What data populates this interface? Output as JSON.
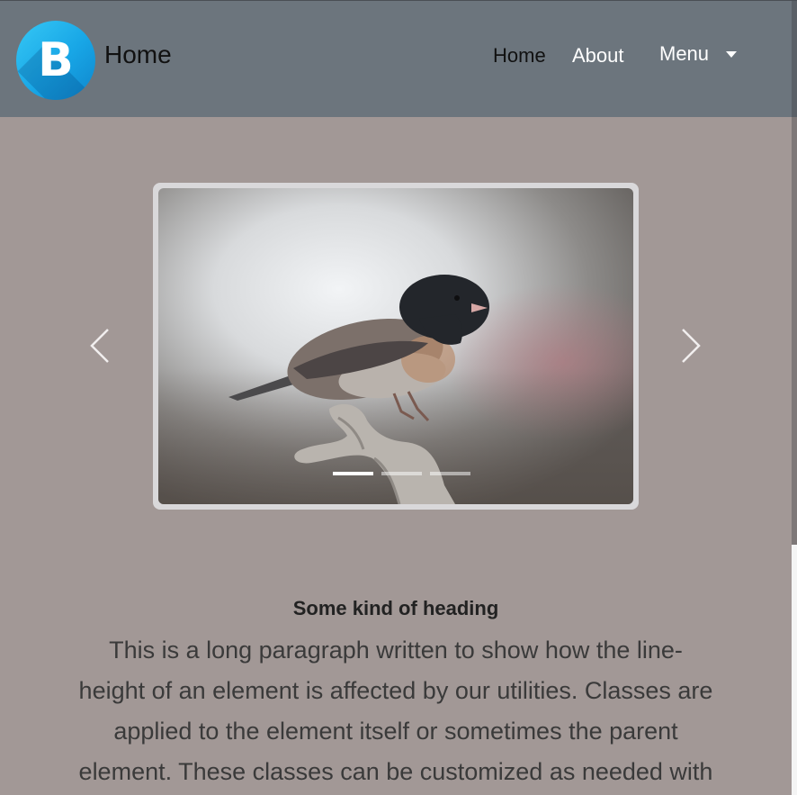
{
  "navbar": {
    "logo_letter": "B",
    "brand": "Home",
    "links": {
      "home": "Home",
      "about": "About",
      "menu": "Menu"
    },
    "menu_icon": "caret-down-icon"
  },
  "carousel": {
    "image_subject": "bird on branch",
    "slide_count": 3,
    "active_index": 0,
    "prev_icon": "chevron-left-icon",
    "next_icon": "chevron-right-icon"
  },
  "content": {
    "heading": "Some kind of heading",
    "paragraph_lines": [
      "This is a long paragraph written to show how the line-",
      "height of an element is affected by our utilities. Classes are",
      "applied to the element itself or sometimes the parent",
      "element. These classes can be customized as needed with"
    ]
  },
  "colors": {
    "page_background": "#a29896",
    "navbar_background": "#6c757d",
    "logo_blue": "#18a6e6"
  }
}
